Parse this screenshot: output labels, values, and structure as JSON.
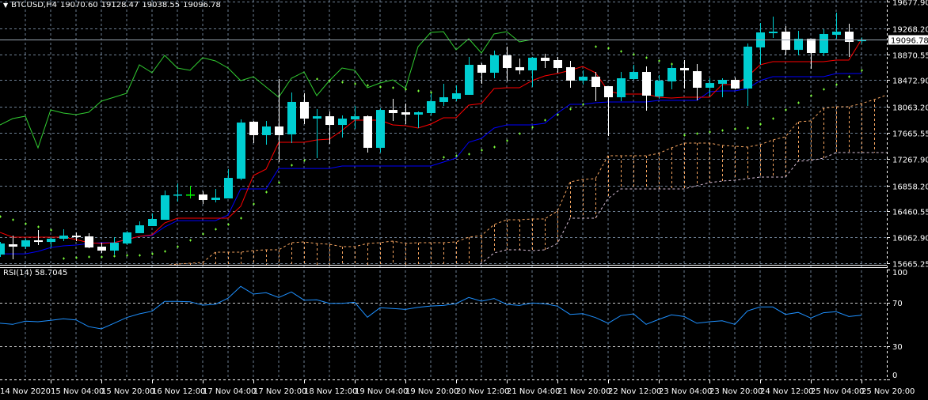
{
  "header": {
    "symbol_label": "BTCUSD,H4",
    "open": "19070.60",
    "high": "19128.47",
    "low": "19038.55",
    "close": "19096.78"
  },
  "price_axis": {
    "labels": [
      "19677.90",
      "19268.20",
      "18870.55",
      "18472.90",
      "18063.20",
      "17665.55",
      "17267.90",
      "16858.20",
      "16460.55",
      "16062.90",
      "15665.25"
    ],
    "current_price": "19096.78"
  },
  "time_axis": {
    "labels": [
      "14 Nov 2020",
      "15 Nov 04:00",
      "15 Nov 20:00",
      "16 Nov 12:00",
      "17 Nov 04:00",
      "17 Nov 20:00",
      "18 Nov 12:00",
      "19 Nov 04:00",
      "19 Nov 20:00",
      "20 Nov 12:00",
      "21 Nov 04:00",
      "21 Nov 20:00",
      "22 Nov 12:00",
      "23 Nov 04:00",
      "23 Nov 20:00",
      "24 Nov 12:00",
      "25 Nov 04:00",
      "25 Nov 20:00"
    ]
  },
  "rsi": {
    "label": "RSI(14) 58.7045",
    "axis_labels": [
      "100",
      "70",
      "30",
      "0"
    ],
    "axis_values": [
      100,
      70,
      30,
      0
    ],
    "levels": [
      70,
      30
    ],
    "range": [
      0,
      101.8
    ],
    "values": [
      51.3,
      50.3,
      53.2,
      52.7,
      53.9,
      55.4,
      54.4,
      48.2,
      46.2,
      51.3,
      56.5,
      59.9,
      62.3,
      71.3,
      71.3,
      71.0,
      67.9,
      68.6,
      74.2,
      85.0,
      78.0,
      79.2,
      74.9,
      79.9,
      72.4,
      72.7,
      69.5,
      69.5,
      70.5,
      56.8,
      65.5,
      64.8,
      64.0,
      65.9,
      67.1,
      67.6,
      69.3,
      74.9,
      71.5,
      73.9,
      68.6,
      67.6,
      69.8,
      69.1,
      66.9,
      59.4,
      60.1,
      56.5,
      51.3,
      58.3,
      59.9,
      50.3,
      54.9,
      59.0,
      57.5,
      51.3,
      52.7,
      53.6,
      50.3,
      62.6,
      66.2,
      66.2,
      59.4,
      61.2,
      56.1,
      60.9,
      61.9,
      57.5,
      58.7
    ]
  },
  "colors": {
    "background": "#000000",
    "grid": "#6e8094",
    "bull": "#00ced1",
    "bear": "#ffffff",
    "doji": "#00ff00",
    "tenkan": "#ff0000",
    "kijun": "#0000ff",
    "chikou": "#32cd32",
    "sar": "#7cff3a",
    "span_a": "#f4a460",
    "span_b": "#d8bfd8",
    "rsi": "#1e90ff"
  },
  "chart_data": {
    "type": "candlestick",
    "ylim": [
      15630,
      19702
    ],
    "ohlc": [
      [
        15799,
        15993,
        15763,
        15969
      ],
      [
        15957,
        16090,
        15727,
        15921
      ],
      [
        15921,
        16042,
        15884,
        16018
      ],
      [
        16018,
        16175,
        15945,
        15993
      ],
      [
        15993,
        16066,
        15908,
        16042
      ],
      [
        16042,
        16187,
        16006,
        16090
      ],
      [
        16090,
        16139,
        16006,
        16066
      ],
      [
        16078,
        16127,
        15896,
        15908
      ],
      [
        15921,
        15981,
        15824,
        15860
      ],
      [
        15860,
        16066,
        15799,
        15981
      ],
      [
        15969,
        16163,
        15945,
        16139
      ],
      [
        16127,
        16309,
        16127,
        16248
      ],
      [
        16236,
        16430,
        16236,
        16345
      ],
      [
        16333,
        16781,
        16333,
        16708
      ],
      [
        16708,
        16890,
        16611,
        16720
      ],
      [
        16720,
        16854,
        16660,
        16720
      ],
      [
        16720,
        16769,
        16575,
        16636
      ],
      [
        16636,
        16805,
        16599,
        16672
      ],
      [
        16660,
        17108,
        16660,
        16975
      ],
      [
        16963,
        17872,
        16939,
        17823
      ],
      [
        17836,
        17848,
        17508,
        17630
      ],
      [
        17630,
        17848,
        17484,
        17763
      ],
      [
        17763,
        18490,
        17217,
        17630
      ],
      [
        17642,
        18284,
        17508,
        18139
      ],
      [
        18139,
        18272,
        17799,
        17884
      ],
      [
        17884,
        18030,
        17278,
        17920
      ],
      [
        17920,
        17993,
        17496,
        17787
      ],
      [
        17787,
        17932,
        17593,
        17884
      ],
      [
        17872,
        18078,
        17726,
        17920
      ],
      [
        17920,
        17932,
        17363,
        17436
      ],
      [
        17436,
        18042,
        17363,
        18017
      ],
      [
        18017,
        18187,
        17848,
        17969
      ],
      [
        17981,
        18114,
        17799,
        17945
      ],
      [
        17945,
        17993,
        17739,
        17981
      ],
      [
        17969,
        18284,
        17932,
        18151
      ],
      [
        18139,
        18417,
        18078,
        18211
      ],
      [
        18187,
        18393,
        18151,
        18272
      ],
      [
        18248,
        18829,
        18248,
        18708
      ],
      [
        18708,
        18732,
        18417,
        18587
      ],
      [
        18587,
        18926,
        18502,
        18854
      ],
      [
        18854,
        18987,
        18454,
        18660
      ],
      [
        18672,
        18805,
        18563,
        18623
      ],
      [
        18623,
        18829,
        18369,
        18817
      ],
      [
        18817,
        18878,
        18660,
        18769
      ],
      [
        18781,
        18829,
        18587,
        18660
      ],
      [
        18672,
        18769,
        18357,
        18466
      ],
      [
        18466,
        18623,
        18405,
        18526
      ],
      [
        18526,
        18599,
        18151,
        18369
      ],
      [
        18381,
        18381,
        17617,
        18211
      ],
      [
        18211,
        18599,
        18151,
        18502
      ],
      [
        18490,
        18708,
        18478,
        18599
      ],
      [
        18599,
        18684,
        18005,
        18236
      ],
      [
        18223,
        18551,
        18187,
        18466
      ],
      [
        18454,
        18720,
        18332,
        18660
      ],
      [
        18660,
        18781,
        18345,
        18623
      ],
      [
        18611,
        18720,
        18163,
        18357
      ],
      [
        18357,
        18502,
        18223,
        18429
      ],
      [
        18417,
        18502,
        18211,
        18478
      ],
      [
        18478,
        18514,
        18332,
        18345
      ],
      [
        18345,
        19035,
        18078,
        18987
      ],
      [
        18975,
        19350,
        18708,
        19205
      ],
      [
        19193,
        19447,
        19120,
        19217
      ],
      [
        19217,
        19302,
        18854,
        18938
      ],
      [
        18938,
        19229,
        18854,
        19108
      ],
      [
        19108,
        19108,
        18648,
        18890
      ],
      [
        18890,
        19254,
        18841,
        19181
      ],
      [
        19169,
        19508,
        19108,
        19217
      ],
      [
        19217,
        19338,
        18829,
        19060
      ],
      [
        19070.6,
        19128.47,
        19038.55,
        19096.78
      ]
    ],
    "tenkan": [
      16139,
      16066,
      16066,
      16066,
      16066,
      16066,
      16030,
      15981,
      15969,
      15981,
      16030,
      16078,
      16102,
      16284,
      16357,
      16357,
      16357,
      16357,
      16357,
      16539,
      17011,
      17108,
      17520,
      17520,
      17520,
      17557,
      17569,
      17702,
      17860,
      17860,
      17860,
      17787,
      17775,
      17739,
      17799,
      17896,
      17896,
      18090,
      18114,
      18345,
      18357,
      18357,
      18466,
      18538,
      18575,
      18623,
      18684,
      18587,
      18308,
      18260,
      18260,
      18260,
      18211,
      18199,
      18211,
      18211,
      18211,
      18405,
      18405,
      18526,
      18708,
      18757,
      18757,
      18757,
      18757,
      18757,
      18781,
      18781,
      19096
    ],
    "kijun": [
      15811,
      15811,
      15811,
      15848,
      15908,
      15933,
      15945,
      15969,
      15981,
      15981,
      16030,
      16078,
      16090,
      16224,
      16320,
      16320,
      16320,
      16320,
      16405,
      16805,
      16805,
      16805,
      17120,
      17120,
      17120,
      17120,
      17120,
      17157,
      17157,
      17157,
      17157,
      17157,
      17157,
      17157,
      17157,
      17217,
      17278,
      17520,
      17581,
      17739,
      17787,
      17787,
      17787,
      17811,
      17969,
      18102,
      18102,
      18126,
      18139,
      18139,
      18139,
      18139,
      18163,
      18163,
      18163,
      18163,
      18296,
      18308,
      18308,
      18345,
      18466,
      18526,
      18526,
      18526,
      18526,
      18526,
      18575,
      18575,
      18575
    ],
    "chikou_shift": 26,
    "cloud_start": 13,
    "span_a": [
      15630,
      15654,
      15666,
      15678,
      15836,
      15836,
      15836,
      15860,
      15872,
      15872,
      15981,
      15993,
      15969,
      15957,
      15921,
      15921,
      15969,
      15981,
      16006,
      15969,
      15981,
      15981,
      15981,
      15993,
      16066,
      16090,
      16260,
      16333,
      16333,
      16345,
      16345,
      16466,
      16914,
      16951,
      16963,
      17314,
      17314,
      17314,
      17314,
      17351,
      17436,
      17508,
      17508,
      17508,
      17472,
      17460,
      17448,
      17484,
      17557,
      17605,
      17836,
      17848,
      18042,
      18066,
      18066,
      18114,
      18175,
      18248
    ],
    "span_b": [
      15520,
      15520,
      15520,
      15520,
      15520,
      15520,
      15520,
      15520,
      15520,
      15520,
      15520,
      15520,
      15520,
      15520,
      15520,
      15520,
      15520,
      15520,
      15520,
      15520,
      15520,
      15520,
      15520,
      15520,
      15520,
      15666,
      15824,
      15872,
      15872,
      15860,
      15872,
      15969,
      16357,
      16357,
      16357,
      16660,
      16805,
      16805,
      16805,
      16805,
      16805,
      16805,
      16854,
      16902,
      16927,
      16939,
      16963,
      16987,
      16987,
      16987,
      17230,
      17242,
      17278,
      17363,
      17363,
      17363,
      17363,
      17363
    ],
    "sar": [
      16381,
      16333,
      16272,
      16224,
      16175,
      15739,
      15751,
      15763,
      15763,
      15775,
      15787,
      15787,
      15811,
      15848,
      15921,
      16018,
      16115,
      16187,
      16260,
      16357,
      16575,
      16757,
      16902,
      17169,
      17242,
      18490,
      18466,
      18442,
      18417,
      18393,
      18369,
      18357,
      18332,
      18308,
      18284,
      17290,
      17314,
      17339,
      17399,
      17448,
      17545,
      17654,
      17751,
      17860,
      17945,
      18030,
      18102,
      18987,
      18963,
      18914,
      18866,
      18817,
      18769,
      18720,
      17629,
      17654,
      17678,
      17702,
      17726,
      17739,
      17799,
      17884,
      18017,
      18126,
      18236,
      18332,
      18405,
      18526,
      18623
    ]
  }
}
